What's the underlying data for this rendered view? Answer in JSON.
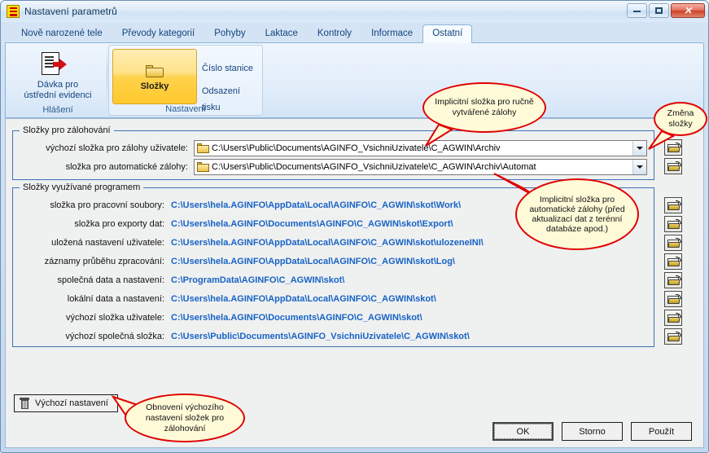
{
  "window": {
    "title": "Nastavení parametrů",
    "app_icon": "app-icon",
    "buttons": {
      "minimize": "minimize-button",
      "maximize": "maximize-button",
      "close": "close-button"
    }
  },
  "tabs": [
    {
      "label": "Nově narozené tele",
      "active": false
    },
    {
      "label": "Převody kategorií",
      "active": false
    },
    {
      "label": "Pohyby",
      "active": false
    },
    {
      "label": "Laktace",
      "active": false
    },
    {
      "label": "Kontroly",
      "active": false
    },
    {
      "label": "Informace",
      "active": false
    },
    {
      "label": "Ostatní",
      "active": true
    }
  ],
  "ribbon": {
    "groups": [
      {
        "name": "hlaseni",
        "label": "Hlášení"
      },
      {
        "name": "nastaveni",
        "label": "Nastavení"
      }
    ],
    "big_buttons": [
      {
        "name": "davka",
        "label_line1": "Dávka pro",
        "label_line2": "ústřední evidenci",
        "selected": false
      },
      {
        "name": "slozky",
        "label": "Složky",
        "selected": true
      }
    ],
    "small_commands": [
      {
        "label": "Číslo stanice"
      },
      {
        "label": "Odsazení tisku"
      }
    ]
  },
  "backup_group": {
    "title": "Složky pro zálohování",
    "rows": [
      {
        "label": "výchozí složka pro zálohy uživatele:",
        "value": "C:\\Users\\Public\\Documents\\AGINFO_VsichniUzivatele\\C_AGWIN\\Archiv"
      },
      {
        "label": "složka pro automatické zálohy:",
        "value": "C:\\Users\\Public\\Documents\\AGINFO_VsichniUzivatele\\C_AGWIN\\Archiv\\Automat"
      }
    ]
  },
  "program_group": {
    "title": "Složky využívané programem",
    "rows": [
      {
        "label": "složka pro pracovní soubory:",
        "value": "C:\\Users\\hela.AGINFO\\AppData\\Local\\AGINFO\\C_AGWIN\\skot\\Work\\"
      },
      {
        "label": "složka pro exporty dat:",
        "value": "C:\\Users\\hela.AGINFO\\Documents\\AGINFO\\C_AGWIN\\skot\\Export\\"
      },
      {
        "label": "uložená nastavení uživatele:",
        "value": "C:\\Users\\hela.AGINFO\\AppData\\Local\\AGINFO\\C_AGWIN\\skot\\ulozeneINI\\"
      },
      {
        "label": "záznamy průběhu zpracování:",
        "value": "C:\\Users\\hela.AGINFO\\AppData\\Local\\AGINFO\\C_AGWIN\\skot\\Log\\"
      },
      {
        "label": "společná data a nastavení:",
        "value": "C:\\ProgramData\\AGINFO\\C_AGWIN\\skot\\"
      },
      {
        "label": "lokální data a nastavení:",
        "value": "C:\\Users\\hela.AGINFO\\AppData\\Local\\AGINFO\\C_AGWIN\\skot\\"
      },
      {
        "label": "výchozí složka uživatele:",
        "value": "C:\\Users\\hela.AGINFO\\Documents\\AGINFO\\C_AGWIN\\skot\\"
      },
      {
        "label": "výchozí společná složka:",
        "value": "C:\\Users\\Public\\Documents\\AGINFO_VsichniUzivatele\\C_AGWIN\\skot\\"
      }
    ]
  },
  "footer": {
    "default_settings_button": "Výchozí nastavení",
    "ok": "OK",
    "cancel": "Storno",
    "apply": "Použít"
  },
  "annotations": [
    {
      "name": "manual-backup-note",
      "text": "Implicitní složka pro ručně vytvářené zálohy"
    },
    {
      "name": "change-folder-note",
      "text": "Změna složky"
    },
    {
      "name": "auto-backup-note",
      "text": "Implicitní složka pro automatické zálohy (před aktualizací dat z terénní databáze apod.)"
    },
    {
      "name": "restore-default-note",
      "text": "Obnovení výchozího nastavení složek pro zálohování"
    }
  ],
  "colors": {
    "annotation_border": "#e00000",
    "annotation_fill": "#fffbd9",
    "path_text": "#1763c6",
    "groupbox_border": "#3a73b5",
    "selected_button": "#ffc82e"
  }
}
